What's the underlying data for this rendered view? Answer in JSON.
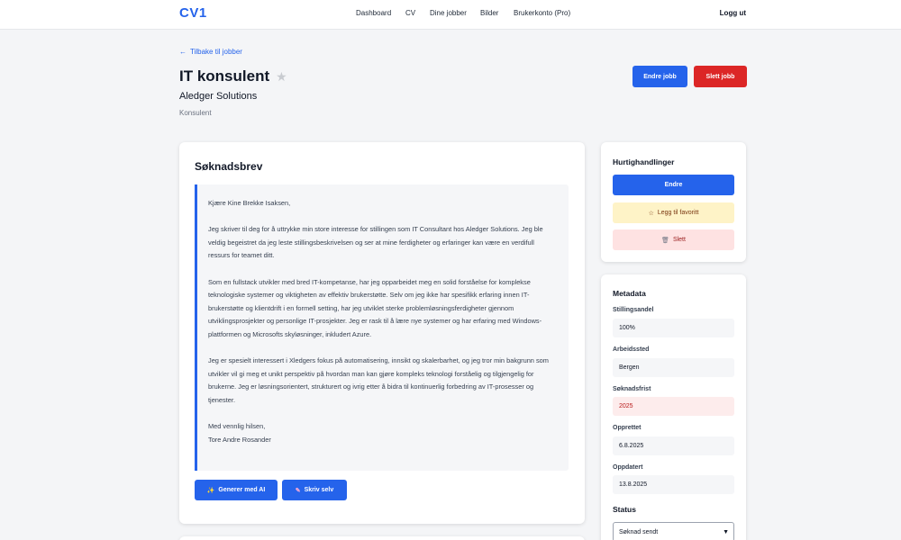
{
  "nav": {
    "brand": "CV1",
    "links": [
      "Dashboard",
      "CV",
      "Dine jobber",
      "Bilder",
      "Brukerkonto (Pro)"
    ],
    "logout": "Logg ut"
  },
  "job": {
    "back_label": "Tilbake til jobber",
    "title": "IT konsulent",
    "company": "Aledger Solutions",
    "type": "Konsulent",
    "edit_label": "Endre jobb",
    "delete_label": "Slett jobb"
  },
  "letter": {
    "heading": "Søknadsbrev",
    "paragraphs": [
      "Kjære Kine Brekke Isaksen,",
      "Jeg skriver til deg for å uttrykke min store interesse for stillingen som IT Consultant hos Aledger Solutions. Jeg ble veldig begeistret da jeg leste stillingsbeskrivelsen og ser at mine ferdigheter og erfaringer kan være en verdifull ressurs for teamet ditt.",
      "Som en fullstack utvikler med bred IT-kompetanse, har jeg opparbeidet meg en solid forståelse for komplekse teknologiske systemer og viktigheten av effektiv brukerstøtte. Selv om jeg ikke har spesifikk erfaring innen IT-brukerstøtte og klientdrift i en formell setting, har jeg utviklet sterke problemløsningsferdigheter gjennom utviklingsprosjekter og personlige IT-prosjekter. Jeg er rask til å lære nye systemer og har erfaring med Windows-plattformen og Microsofts skyløsninger, inkludert Azure.",
      "Jeg er spesielt interessert i Xledgers fokus på automatisering, innsikt og skalerbarhet, og jeg tror min bakgrunn som utvikler vil gi meg et unikt perspektiv på hvordan man kan gjøre kompleks teknologi forståelig og tilgjengelig for brukerne. Jeg er løsningsorientert, strukturert og ivrig etter å bidra til kontinuerlig forbedring av IT-prosesser og tjenester."
    ],
    "closing": "Med vennlig hilsen,",
    "signature": "Tore Andre Rosander",
    "generate_ai_label": "Generer med AI",
    "write_self_label": "Skriv selv"
  },
  "quick_actions": {
    "heading": "Hurtighandlinger",
    "edit_label": "Endre",
    "favorite_label": "Legg til favoritt",
    "delete_label": "Slett"
  },
  "metadata": {
    "heading": "Metadata",
    "fields": [
      {
        "label": "Stillingsandel",
        "value": "100%"
      },
      {
        "label": "Arbeidssted",
        "value": "Bergen"
      },
      {
        "label": "Søknadsfrist",
        "value": "2025"
      },
      {
        "label": "Opprettet",
        "value": "6.8.2025"
      },
      {
        "label": "Oppdatert",
        "value": "13.8.2025"
      }
    ],
    "status_heading": "Status",
    "status_value": "Søknad sendt"
  },
  "colors": {
    "primary": "#2563eb",
    "danger": "#dc2626",
    "favorite_bg": "#fef3c7",
    "delete_bg": "#fee2e2"
  }
}
